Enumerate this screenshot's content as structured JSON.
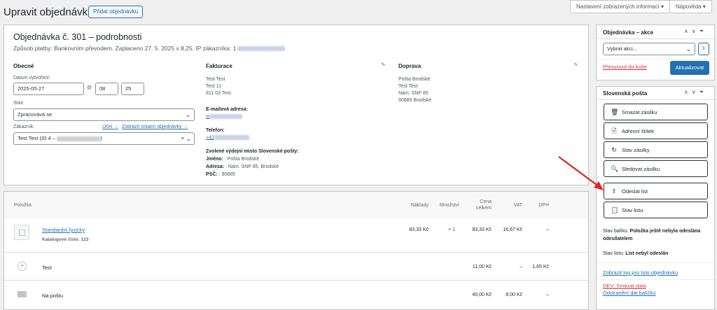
{
  "header": {
    "title": "Upravit objednávku",
    "add_button": "Přidat objednávku",
    "screen_options": "Nastavení zobrazených informací ▾",
    "help": "Nápověda ▾"
  },
  "order": {
    "title": "Objednávka č. 301 – podrobnosti",
    "subtitle": "Způsob platby: Bankovním převodem. Zaplaceno 27. 5. 2025 v 8.25. IP zákazníka: 1"
  },
  "general": {
    "heading": "Obecné",
    "date_label": "Datum vytvoření:",
    "date": "2025-05-27",
    "at": "@",
    "hour": "08",
    "colon": ":",
    "minute": "25",
    "status_label": "Stav:",
    "status": "Zpracovává se",
    "customer_label": "Zákazník:",
    "profile_link": "Účet →",
    "other_orders_link": "Zobrazit ostatní objednávky →",
    "customer": "Test Test (ID 4 – ",
    "customer_clear": "×"
  },
  "billing": {
    "heading": "Fakturace",
    "line1": "Test Test",
    "line2": "Test 11",
    "line3": "811 03 Test",
    "email_label": "E-mailová adresa:",
    "email": "m",
    "phone_label": "Telefon:",
    "phone": "+42",
    "pickup_label": "Zvolené výdejní místo Slovenské pošty:",
    "pickup_name_label": "Jméno:",
    "pickup_name": " : Pošta Brodské",
    "pickup_addr_label": "Adresa:",
    "pickup_addr": " : Nám. SNP 85, Brodské",
    "pickup_zip_label": "PSČ:",
    "pickup_zip": " : 90885"
  },
  "shipping": {
    "heading": "Doprava",
    "line1": "Pošta Brodské",
    "line2": "Test Test",
    "line3": "Nám. SNP 85",
    "line4": "90885 Brodské"
  },
  "items": {
    "col_item": "Položka",
    "col_cost": "Náklady",
    "col_qty": "Množství",
    "col_total1": "Cena",
    "col_total2": "celkem",
    "col_vat": "VAT",
    "col_dph": "DPH",
    "rows": [
      {
        "name": "Standardní fyzický",
        "sku": "Katalogové číslo: 123",
        "cost": "83,33 Kč",
        "qty": "× 1",
        "total": "83,33 Kč",
        "vat": "16,67 Kč",
        "dph": "–"
      },
      {
        "name": "Test",
        "total": "11,00 Kč",
        "vat": "–",
        "dph": "1,65 Kč"
      },
      {
        "name": "Na poštu",
        "total": "40,00 Kč",
        "vat": "8,00 Kč",
        "dph": "–"
      }
    ]
  },
  "actions": {
    "heading": "Objednávka – akce",
    "select": "Vybrat akci...",
    "go": "›",
    "trash": "Přesunout do koše",
    "update": "Aktualizovat"
  },
  "sposta": {
    "heading": "Slovenská pošta",
    "buttons": [
      "Smazat zásilku",
      "Adresní štítek",
      "Stav zásilky",
      "Sledovat zásilku",
      "Odeslat list",
      "Stav listu"
    ],
    "pkg_label": "Stav balíku: ",
    "pkg_status": "Položka ještě nebyla odeslána odesílatelem",
    "sheet_label": "Stav listu: ",
    "sheet_status": "List nebyl odeslán",
    "log_link": "Zobrazit log pro tuto objednávku",
    "dev_link": "DEV: Smazat data",
    "remove_link": "Odstranění dat balíčku"
  },
  "colors": {
    "accent": "#2271b1",
    "arrow": "#e8211c"
  }
}
